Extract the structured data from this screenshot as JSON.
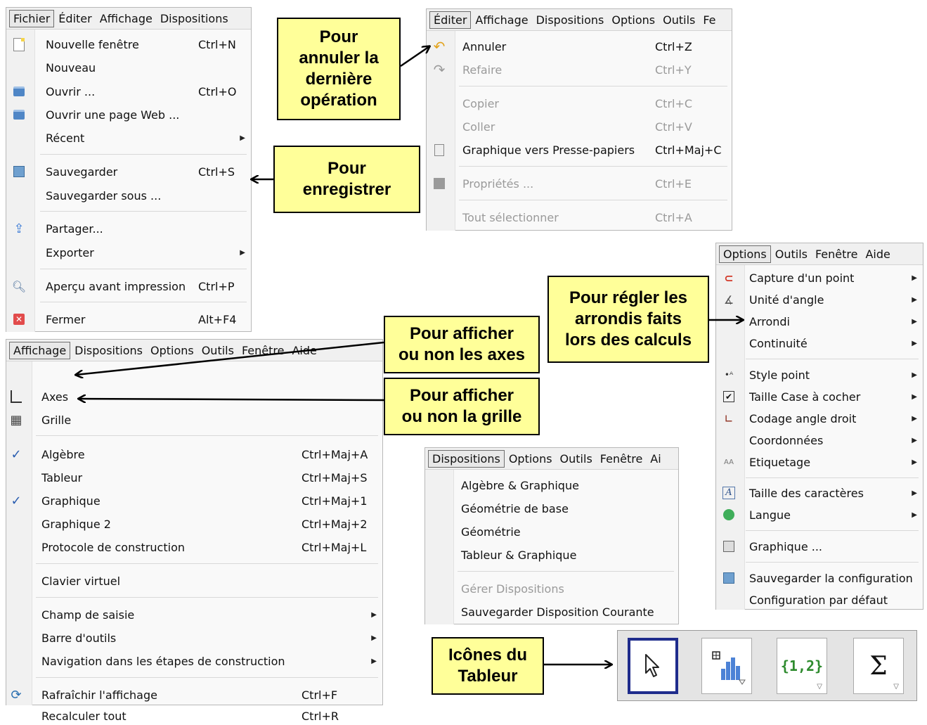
{
  "fichier_menu": {
    "menubar": [
      "Fichier",
      "Éditer",
      "Affichage",
      "Dispositions"
    ],
    "items": [
      {
        "label": "Nouvelle fenêtre",
        "shortcut": "Ctrl+N",
        "icon": "new-window-icon"
      },
      {
        "label": "Nouveau",
        "shortcut": ""
      },
      {
        "label": "Ouvrir ...",
        "shortcut": "Ctrl+O",
        "icon": "open-folder-icon"
      },
      {
        "label": "Ouvrir une page Web ...",
        "shortcut": "",
        "icon": "open-web-icon"
      },
      {
        "label": "Récent",
        "shortcut": "",
        "submenu": true
      },
      {
        "label": "Sauvegarder",
        "shortcut": "Ctrl+S",
        "icon": "save-icon"
      },
      {
        "label": "Sauvegarder sous ...",
        "shortcut": ""
      },
      {
        "label": "Partager...",
        "shortcut": "",
        "icon": "share-icon"
      },
      {
        "label": "Exporter",
        "shortcut": "",
        "submenu": true
      },
      {
        "label": "Aperçu avant impression",
        "shortcut": "Ctrl+P",
        "icon": "print-preview-icon"
      },
      {
        "label": "Fermer",
        "shortcut": "Alt+F4",
        "icon": "close-icon"
      }
    ]
  },
  "editer_menu": {
    "menubar": [
      "Éditer",
      "Affichage",
      "Dispositions",
      "Options",
      "Outils",
      "Fe"
    ],
    "items": [
      {
        "label": "Annuler",
        "shortcut": "Ctrl+Z",
        "icon": "undo-icon"
      },
      {
        "label": "Refaire",
        "shortcut": "Ctrl+Y",
        "icon": "redo-icon",
        "disabled": true
      },
      {
        "label": "Copier",
        "shortcut": "Ctrl+C",
        "disabled": true
      },
      {
        "label": "Coller",
        "shortcut": "Ctrl+V",
        "disabled": true
      },
      {
        "label": "Graphique vers Presse-papiers",
        "shortcut": "Ctrl+Maj+C",
        "icon": "clipboard-icon"
      },
      {
        "label": "Propriétés ...",
        "shortcut": "Ctrl+E",
        "icon": "properties-icon",
        "disabled": true
      },
      {
        "label": "Tout sélectionner",
        "shortcut": "Ctrl+A",
        "disabled": true
      }
    ]
  },
  "options_menu": {
    "menubar": [
      "Options",
      "Outils",
      "Fenêtre",
      "Aide"
    ],
    "items": [
      {
        "label": "Capture d'un point",
        "icon": "magnet-icon",
        "submenu": true
      },
      {
        "label": "Unité d'angle",
        "icon": "angle-icon",
        "submenu": true
      },
      {
        "label": "Arrondi",
        "submenu": true
      },
      {
        "label": "Continuité",
        "submenu": true
      },
      {
        "label": "Style point",
        "icon": "point-style-icon",
        "submenu": true
      },
      {
        "label": "Taille Case à cocher",
        "icon": "checkbox-icon",
        "submenu": true
      },
      {
        "label": "Codage angle droit",
        "icon": "right-angle-icon",
        "submenu": true
      },
      {
        "label": "Coordonnées",
        "submenu": true
      },
      {
        "label": "Etiquetage",
        "icon": "label-icon",
        "submenu": true
      },
      {
        "label": "Taille des caractères",
        "icon": "font-size-icon",
        "submenu": true
      },
      {
        "label": "Langue",
        "icon": "globe-icon",
        "submenu": true
      },
      {
        "label": "Graphique ...",
        "icon": "graphics-icon"
      },
      {
        "label": "Sauvegarder la configuration",
        "icon": "save-config-icon"
      },
      {
        "label": "Configuration par défaut"
      }
    ]
  },
  "affichage_menu": {
    "menubar": [
      "Affichage",
      "Dispositions",
      "Options",
      "Outils",
      "Fenêtre",
      "Aide"
    ],
    "items": [
      {
        "label": "Axes",
        "shortcut": "",
        "icon": "axes-icon"
      },
      {
        "label": "Grille",
        "shortcut": "",
        "icon": "grid-icon"
      },
      {
        "label": "Algèbre",
        "shortcut": "Ctrl+Maj+A",
        "checked": true
      },
      {
        "label": "Tableur",
        "shortcut": "Ctrl+Maj+S"
      },
      {
        "label": "Graphique",
        "shortcut": "Ctrl+Maj+1",
        "checked": true
      },
      {
        "label": "Graphique 2",
        "shortcut": "Ctrl+Maj+2"
      },
      {
        "label": "Protocole de construction",
        "shortcut": "Ctrl+Maj+L"
      },
      {
        "label": "Clavier virtuel",
        "shortcut": ""
      },
      {
        "label": "Champ de saisie",
        "shortcut": "",
        "submenu": true
      },
      {
        "label": "Barre d'outils",
        "shortcut": "",
        "submenu": true
      },
      {
        "label": "Navigation dans les étapes de construction",
        "shortcut": "",
        "submenu": true
      },
      {
        "label": "Rafraîchir l'affichage",
        "shortcut": "Ctrl+F",
        "icon": "refresh-icon"
      },
      {
        "label": "Recalculer tout",
        "shortcut": "Ctrl+R"
      }
    ]
  },
  "dispositions_menu": {
    "menubar": [
      "Dispositions",
      "Options",
      "Outils",
      "Fenêtre",
      "Ai"
    ],
    "items": [
      {
        "label": "Algèbre & Graphique"
      },
      {
        "label": "Géométrie de base"
      },
      {
        "label": "Géométrie"
      },
      {
        "label": "Tableur & Graphique"
      },
      {
        "label": "Gérer Dispositions",
        "disabled": true
      },
      {
        "label": "Sauvegarder Disposition Courante"
      }
    ]
  },
  "callouts": {
    "annuler": [
      "Pour",
      "annuler la",
      "dernière",
      "opération"
    ],
    "enregistrer": [
      "Pour",
      "enregistrer"
    ],
    "arrondis": [
      "Pour régler les",
      "arrondis faits",
      "lors des calculs"
    ],
    "axes": [
      "Pour afficher",
      "ou non les axes"
    ],
    "grille": [
      "Pour afficher",
      "ou non la grille"
    ],
    "tableur": [
      "Icônes du",
      "Tableur"
    ]
  },
  "toolbar": {
    "buttons": [
      {
        "icon": "move-cursor-icon",
        "selected": true
      },
      {
        "icon": "histogram-icon"
      },
      {
        "icon": "list-icon",
        "text": "{1,2}"
      },
      {
        "icon": "sum-icon",
        "text": "Σ"
      }
    ]
  },
  "colors": {
    "callout_bg": "#ffff99",
    "selected_tool_border": "#1f2c8c"
  }
}
